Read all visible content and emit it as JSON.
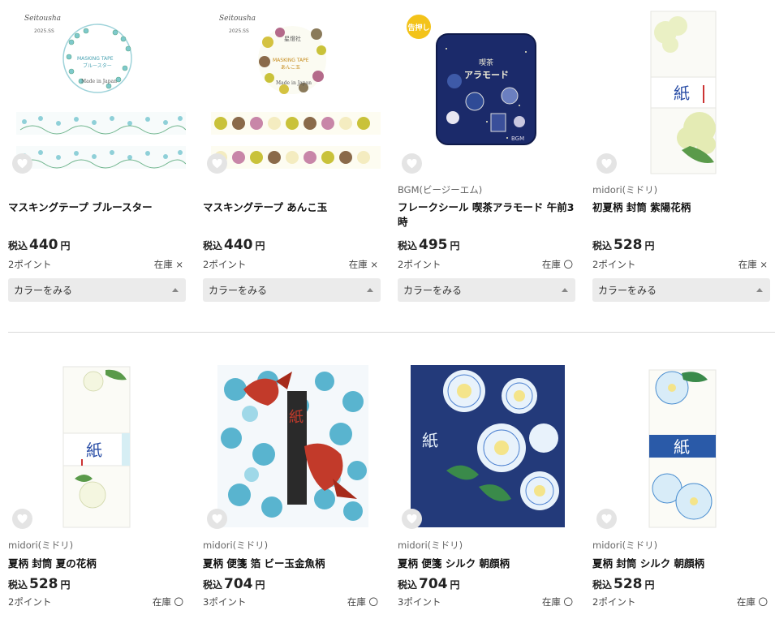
{
  "labels": {
    "tax": "税込",
    "yen": "円",
    "colors_button": "カラーをみる",
    "stock_label": "在庫"
  },
  "products": [
    {
      "brand": "",
      "name": "マスキングテープ ブルースター",
      "price": "440",
      "points": "2ポイント",
      "stock": "×",
      "image_text": {
        "logo": "Seitousha",
        "season": "2025.SS",
        "tape": "MASKING TAPE",
        "sub": "ブルースター",
        "made": "Made in Japan"
      }
    },
    {
      "brand": "",
      "name": "マスキングテープ あんこ玉",
      "price": "440",
      "points": "2ポイント",
      "stock": "×",
      "image_text": {
        "logo": "Seitousha",
        "season": "2025.SS",
        "maker": "星燈社",
        "tape": "MASKING TAPE",
        "sub": "あんこ玉",
        "made": "Made in Japan"
      }
    },
    {
      "brand": "BGM(ビージーエム)",
      "name": "フレークシール 喫茶アラモード 午前3時",
      "price": "495",
      "points": "2ポイント",
      "stock": "〇",
      "badge": "告押し",
      "image_text": {
        "title_top": "喫茶",
        "title": "アラモード",
        "maker": "BGM"
      }
    },
    {
      "brand": "midori(ミドリ)",
      "name": "初夏柄 封筒 紫陽花柄",
      "price": "528",
      "points": "2ポイント",
      "stock": "×",
      "image_text": {
        "kanji": "紙"
      }
    },
    {
      "brand": "midori(ミドリ)",
      "name": "夏柄 封筒 夏の花柄",
      "price": "528",
      "points": "2ポイント",
      "stock": "〇",
      "image_text": {
        "kanji": "紙"
      }
    },
    {
      "brand": "midori(ミドリ)",
      "name": "夏柄 便箋 箔 ビー玉金魚柄",
      "price": "704",
      "points": "3ポイント",
      "stock": "〇",
      "image_text": {
        "kanji": "紙"
      }
    },
    {
      "brand": "midori(ミドリ)",
      "name": "夏柄 便箋 シルク 朝顔柄",
      "price": "704",
      "points": "3ポイント",
      "stock": "〇",
      "image_text": {
        "kanji": "紙"
      }
    },
    {
      "brand": "midori(ミドリ)",
      "name": "夏柄 封筒 シルク 朝顔柄",
      "price": "528",
      "points": "2ポイント",
      "stock": "〇",
      "image_text": {
        "kanji": "紙"
      }
    }
  ],
  "icons": {
    "favorite": "heart-icon",
    "toggle": "caret-up-icon"
  },
  "colors": {
    "button_bg": "#ebebeb",
    "fav_bg": "#e4e4e4",
    "badge": "#f3c31a",
    "text": "#111111"
  }
}
